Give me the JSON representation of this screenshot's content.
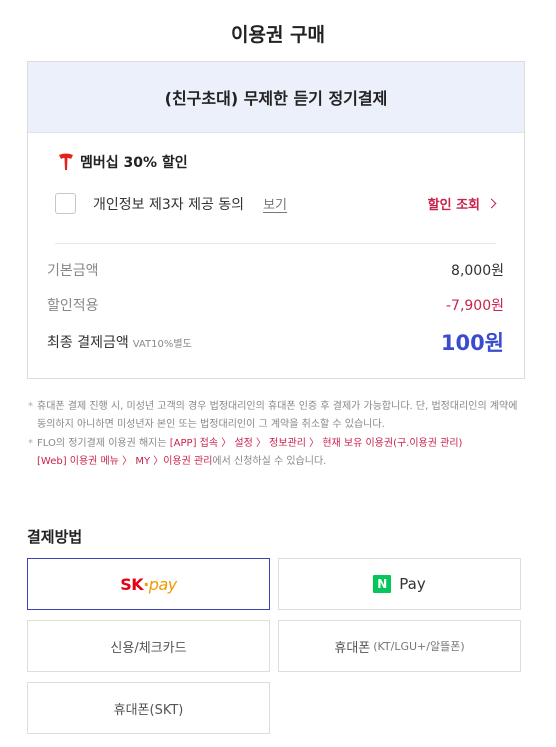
{
  "page_title": "이용권 구매",
  "product": {
    "name": "(친구초대) 무제한 듣기 정기결제"
  },
  "membership": {
    "label": "멤버십 30% 할인",
    "icon": "t-membership-icon",
    "consent_label": "개인정보 제3자 제공 동의",
    "view_link": "보기",
    "discount_lookup": "할인 조회"
  },
  "pricing": {
    "base_label": "기본금액",
    "base_value": "8,000원",
    "discount_label": "할인적용",
    "discount_value": "-7,900원",
    "final_label": "최종 결제금액",
    "vat_note": "VAT10%별도",
    "final_value": "100원"
  },
  "notes": {
    "note1": "휴대폰 결제 진행 시, 미성년 고객의 경우 법정대리인의 휴대폰 인증 후 결제가 가능합니다. 단, 법정대리인의 계약에 동의하지 아니하면 미성년자 본인 또는 법정대리인이 그 계약을 취소할 수 있습니다.",
    "note2_prefix": "FLO의 정기결제 이용권 해지는 ",
    "note2_app": "[APP] 접속 〉 설정 〉 정보관리 〉 현재 보유 이용권(구.이용권 관리)",
    "note2_web": "[Web] 이용권 메뉴 〉 MY 〉이용권 관리",
    "note2_suffix": "에서 신청하실 수 있습니다."
  },
  "payment": {
    "title": "결제방법",
    "options": {
      "sk_pay": {
        "sk": "SK",
        "pay": "pay"
      },
      "naver_pay": {
        "n": "N",
        "label": "Pay"
      },
      "card": "신용/체크카드",
      "phone": "휴대폰",
      "phone_sub": "(KT/LGU+/알뜰폰)",
      "phone_skt": "휴대폰(SKT)"
    },
    "selected": "sk_pay"
  },
  "colors": {
    "accent_blue": "#3b4ccf",
    "discount_red": "#c8234c",
    "header_bg": "#ebf0fb",
    "naver_green": "#03c75a",
    "sk_red": "#e60012",
    "sk_orange": "#f39800"
  }
}
